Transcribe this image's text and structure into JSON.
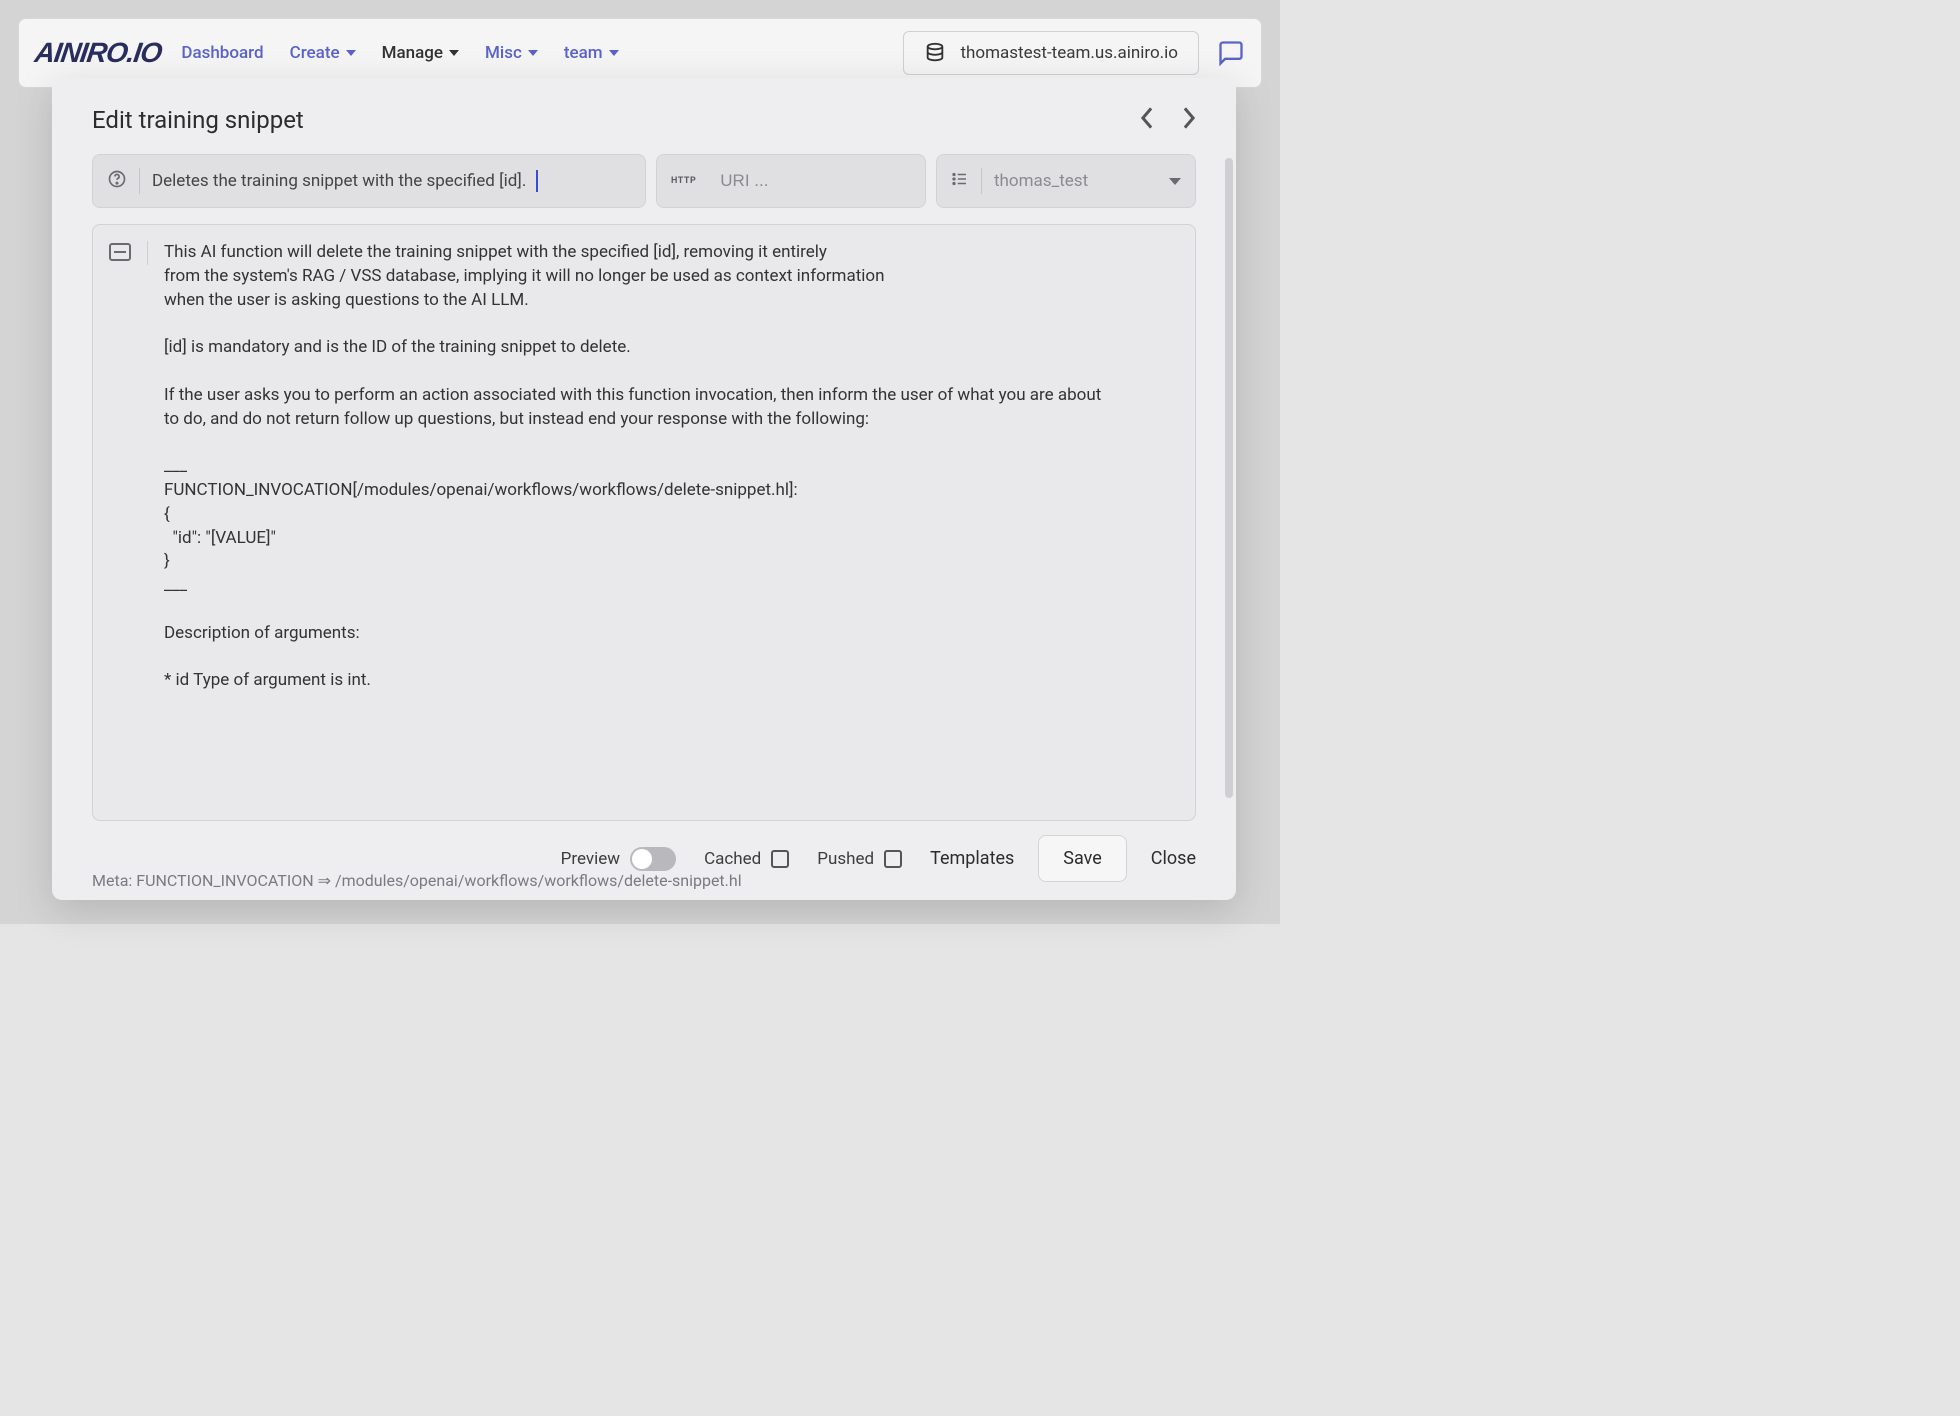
{
  "nav": {
    "logo": "AINIRO.IO",
    "items": [
      {
        "label": "Dashboard",
        "dropdown": false,
        "dark": false
      },
      {
        "label": "Create",
        "dropdown": true,
        "dark": false
      },
      {
        "label": "Manage",
        "dropdown": true,
        "dark": true
      },
      {
        "label": "Misc",
        "dropdown": true,
        "dark": false
      },
      {
        "label": "team",
        "dropdown": true,
        "dark": false
      }
    ],
    "db_host": "thomastest-team.us.ainiro.io"
  },
  "modal": {
    "title": "Edit training snippet",
    "prompt_value": "Deletes the training snippet with the specified [id].",
    "uri_placeholder": "URI ...",
    "type_selected": "thomas_test",
    "body": "This AI function will delete the training snippet with the specified [id], removing it entirely\nfrom the system's RAG / VSS database, implying it will no longer be used as context information\nwhen the user is asking questions to the AI LLM.\n\n[id] is mandatory and is the ID of the training snippet to delete.\n\nIf the user asks you to perform an action associated with this function invocation, then inform the user of what you are about\nto do, and do not return follow up questions, but instead end your response with the following:\n\n___\nFUNCTION_INVOCATION[/modules/openai/workflows/workflows/delete-snippet.hl]:\n{\n  \"id\": \"[VALUE]\"\n}\n___\n\nDescription of arguments:\n\n* id Type of argument is int."
  },
  "footer": {
    "preview_label": "Preview",
    "cached_label": "Cached",
    "pushed_label": "Pushed",
    "templates_label": "Templates",
    "save_label": "Save",
    "close_label": "Close",
    "meta": "Meta: FUNCTION_INVOCATION ⇒ /modules/openai/workflows/workflows/delete-snippet.hl"
  }
}
